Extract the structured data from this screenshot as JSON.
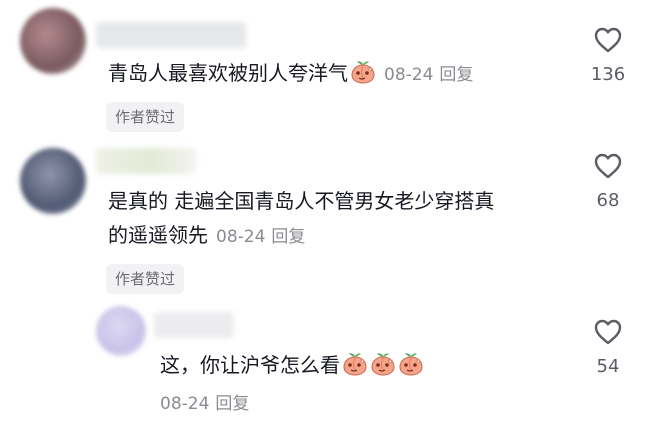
{
  "comments": [
    {
      "text": "青岛人最喜欢被别人夸洋气",
      "emoji_count": 1,
      "emoji_icon": "peach-face-icon",
      "date": "08-24",
      "reply_label": "回复",
      "badge": "作者赞过",
      "likes": "136"
    },
    {
      "text_line1": "是真的  走遍全国青岛人不管男女老少穿搭真",
      "text_line2": "的遥遥领先",
      "date": "08-24",
      "reply_label": "回复",
      "badge": "作者赞过",
      "likes": "68"
    },
    {
      "text": "这，你让沪爷怎么看",
      "emoji_count": 3,
      "emoji_icon": "peach-face-icon",
      "date": "08-24",
      "reply_label": "回复",
      "likes": "54"
    }
  ],
  "colors": {
    "text": "#161823",
    "meta": "#8a8b91",
    "badge_bg": "#f2f2f4"
  }
}
